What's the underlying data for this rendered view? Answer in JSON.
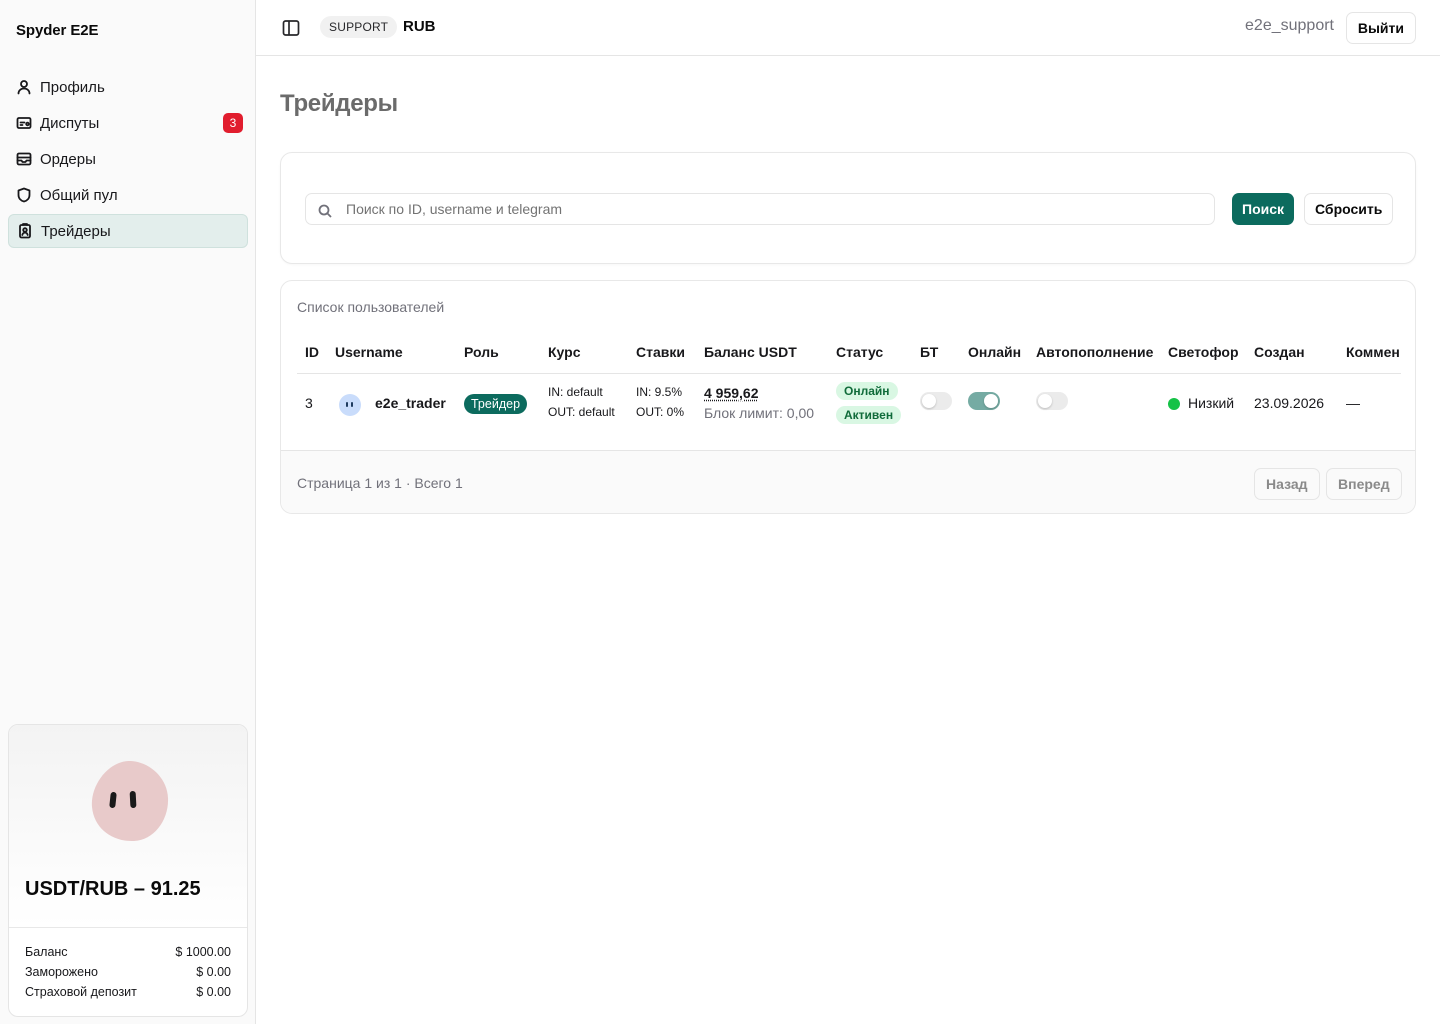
{
  "sidebar": {
    "brand": "Spyder E2E",
    "items": [
      {
        "label": "Профиль",
        "icon": "user-icon"
      },
      {
        "label": "Диспуты",
        "icon": "ticket-icon",
        "badge": "3"
      },
      {
        "label": "Ордеры",
        "icon": "inbox-icon"
      },
      {
        "label": "Общий пул",
        "icon": "shield-icon"
      },
      {
        "label": "Трейдеры",
        "icon": "badge-icon",
        "active": true
      }
    ],
    "rate_card": {
      "title": "USDT/RUB – 91.25",
      "rows": [
        {
          "label": "Баланс",
          "value": "$ 1000.00"
        },
        {
          "label": "Заморожено",
          "value": "$ 0.00"
        },
        {
          "label": "Страховой депозит",
          "value": "$ 0.00"
        }
      ]
    }
  },
  "header": {
    "role": "SUPPORT",
    "currency": "RUB",
    "username": "e2e_support",
    "logout_label": "Выйти"
  },
  "main": {
    "title": "Трейдеры",
    "search": {
      "placeholder": "Поиск по ID, username и telegram",
      "value": "",
      "search_label": "Поиск",
      "reset_label": "Сбросить"
    },
    "table": {
      "caption": "Список пользователей",
      "columns": [
        "ID",
        "Username",
        "Роль",
        "Курс",
        "Ставки",
        "Баланс USDT",
        "Статус",
        "БТ",
        "Онлайн",
        "Автопополнение",
        "Светофор",
        "Создан",
        "Коммен"
      ],
      "rows": [
        {
          "id": "3",
          "username": "e2e_trader",
          "role": "Трейдер",
          "rate_in": "IN: default",
          "rate_out": "OUT: default",
          "stake_in": "IN: 9.5%",
          "stake_out": "OUT: 0%",
          "balance": "4 959,62",
          "block_limit": "Блок лимит: 0,00",
          "status_online": "Онлайн",
          "status_active": "Активен",
          "bt": false,
          "online": true,
          "autotopup": false,
          "traffic": "Низкий",
          "traffic_color": "#16c247",
          "created": "23.09.2026",
          "comment": "—"
        }
      ]
    },
    "pagination": {
      "text": "Страница 1 из 1 · Всего 1",
      "prev_label": "Назад",
      "next_label": "Вперед"
    }
  },
  "colors": {
    "brand_green": "#0c6b5e",
    "badge_red": "#e11d2e",
    "status_green_bg": "#d9f7e3"
  }
}
